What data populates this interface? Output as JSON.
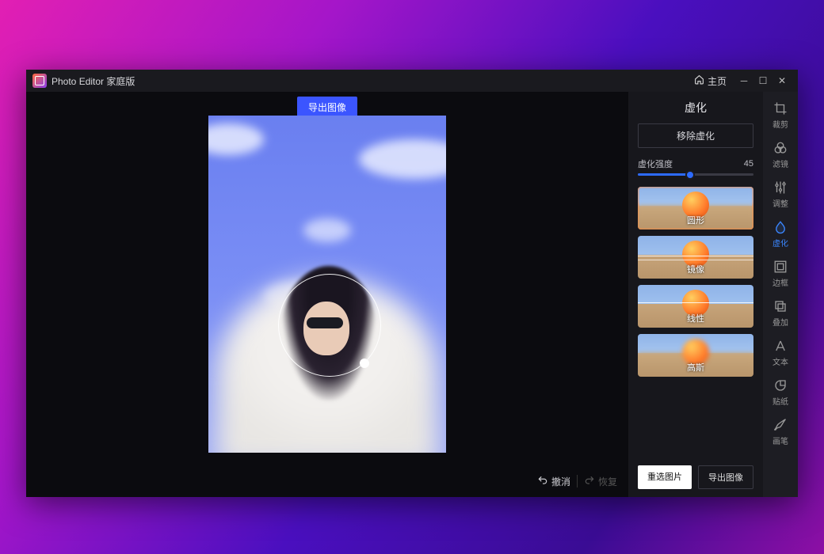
{
  "app": {
    "title": "Photo Editor 家庭版"
  },
  "titlebar": {
    "home": "主页"
  },
  "canvas": {
    "export_top": "导出图像",
    "undo": "撤消",
    "redo": "恢复"
  },
  "panel": {
    "title": "虚化",
    "remove": "移除虚化",
    "strength_label": "虚化强度",
    "strength_value": "45",
    "presets": [
      {
        "label": "圆形"
      },
      {
        "label": "镜像"
      },
      {
        "label": "线性"
      },
      {
        "label": "高斯"
      }
    ],
    "reselect": "重选图片",
    "export": "导出图像"
  },
  "rail": [
    {
      "id": "crop",
      "label": "裁剪"
    },
    {
      "id": "filter",
      "label": "滤镜"
    },
    {
      "id": "adjust",
      "label": "调整"
    },
    {
      "id": "blur",
      "label": "虚化",
      "active": true
    },
    {
      "id": "frame",
      "label": "边框"
    },
    {
      "id": "overlay",
      "label": "叠加"
    },
    {
      "id": "text",
      "label": "文本"
    },
    {
      "id": "sticker",
      "label": "贴纸"
    },
    {
      "id": "brush",
      "label": "画笔"
    }
  ]
}
